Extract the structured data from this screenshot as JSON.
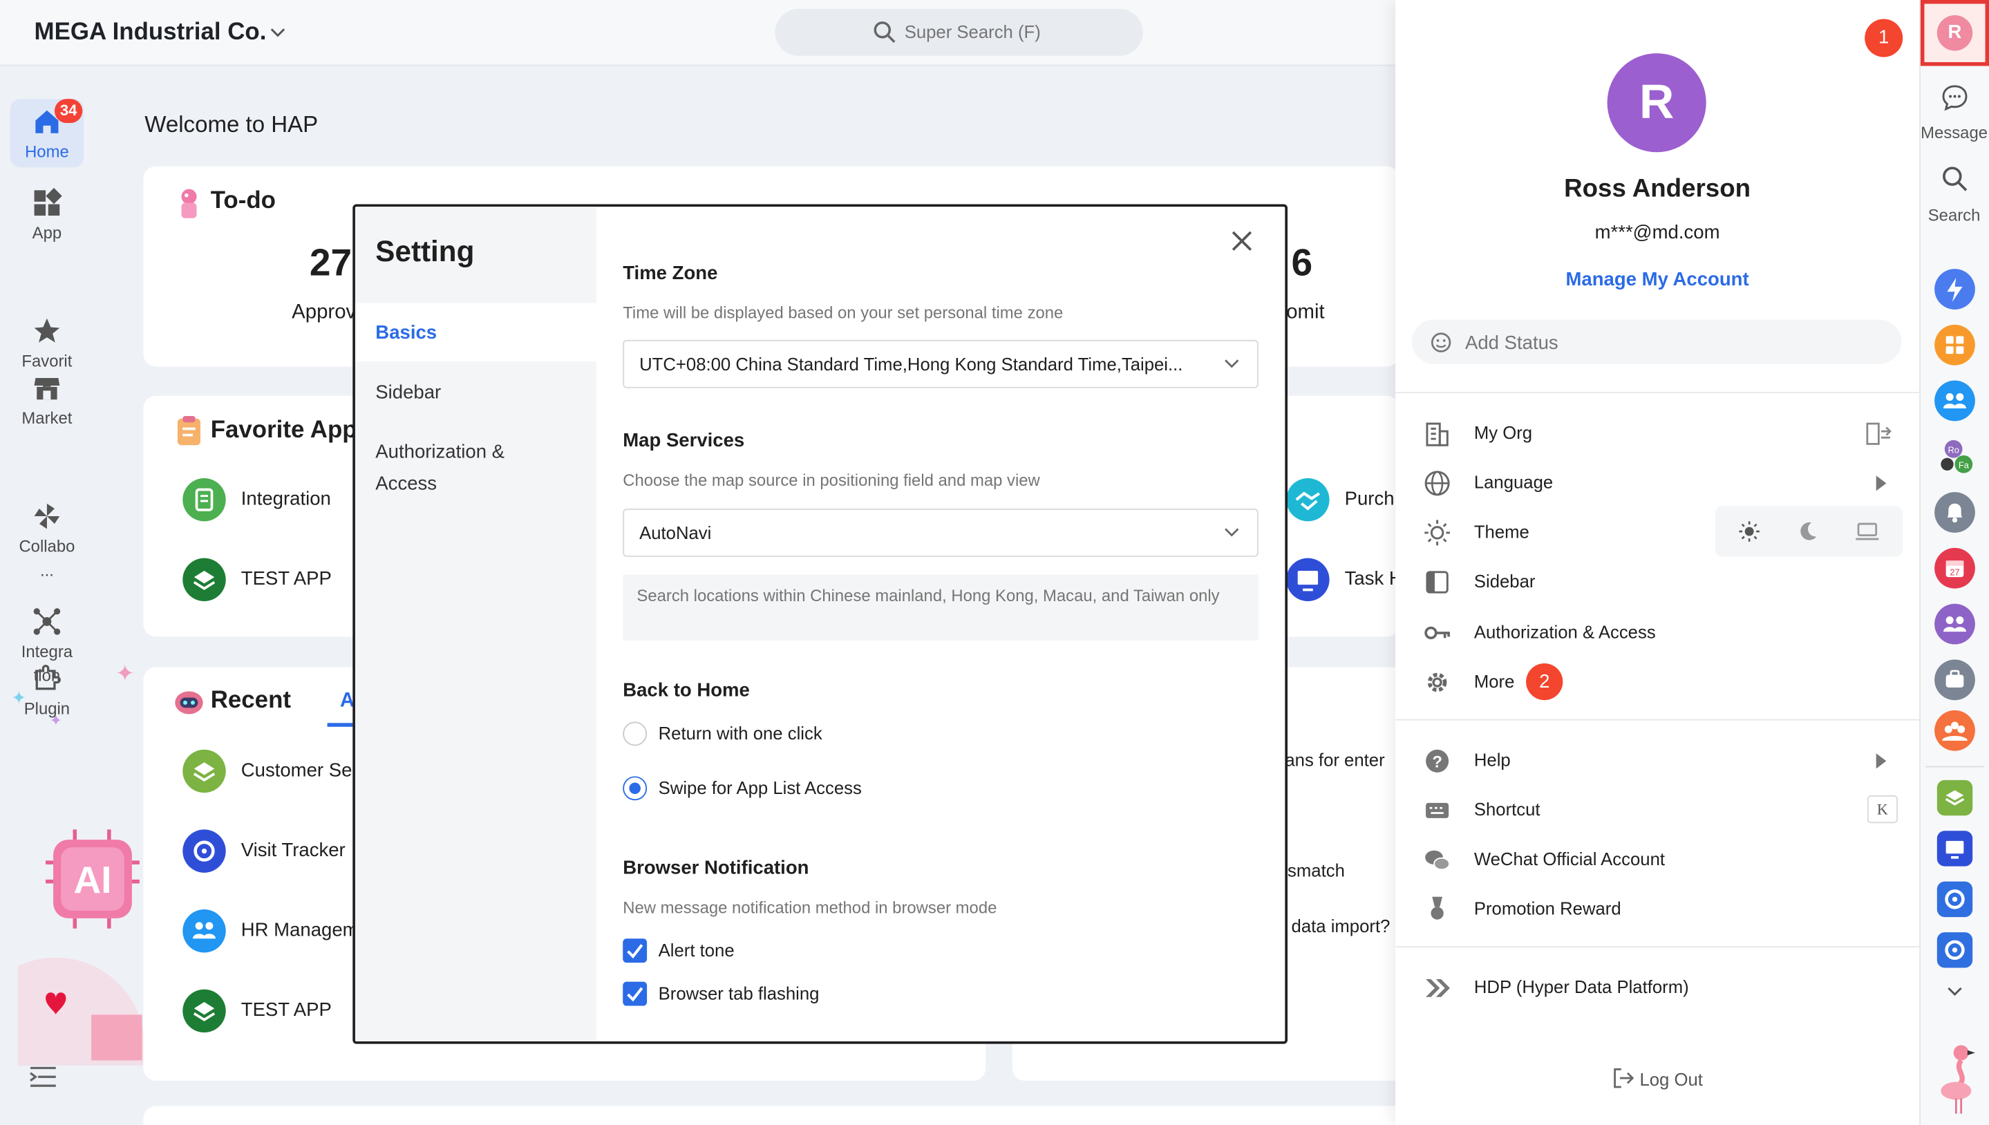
{
  "topbar": {
    "org_name": "MEGA Industrial Co.",
    "search_placeholder": "Super Search (F)"
  },
  "leftnav": {
    "home_badge": "34",
    "items": [
      {
        "label": "Home"
      },
      {
        "label": "App"
      },
      {
        "label": "Favorit\ne"
      },
      {
        "label": "Market"
      },
      {
        "label": "Collabo\n..."
      },
      {
        "label": "Integra\ntion"
      },
      {
        "label": "Plugin"
      }
    ]
  },
  "main": {
    "welcome": "Welcome to HAP",
    "todo": {
      "title": "To-do",
      "count_left": "27",
      "label_left": "Approv",
      "count_right": "6",
      "label_right": "omit"
    },
    "favorite": {
      "title": "Favorite App",
      "apps": [
        {
          "label": "Integration"
        },
        {
          "label": "TEST APP"
        },
        {
          "label": "Purch"
        },
        {
          "label": "Task H"
        }
      ]
    },
    "recent": {
      "title": "Recent",
      "tab_partial": "A",
      "apps": [
        {
          "label": "Customer Se"
        },
        {
          "label": "Visit Tracker"
        },
        {
          "label": "HR Managem"
        },
        {
          "label": "TEST APP"
        }
      ]
    },
    "right_card_lines": [
      "ans for enter",
      "smatch",
      "data import?"
    ]
  },
  "modal": {
    "title": "Setting",
    "side": {
      "basics": "Basics",
      "sidebar": "Sidebar",
      "auth": "Authorization &\nAccess"
    },
    "timezone": {
      "head": "Time Zone",
      "desc": "Time will be displayed based on your set personal time zone",
      "value": "UTC+08:00 China Standard Time,Hong Kong Standard Time,Taipei..."
    },
    "map": {
      "head": "Map Services",
      "desc": "Choose the map source in positioning field and map view",
      "value": "AutoNavi",
      "note": "Search locations within Chinese mainland, Hong Kong, Macau, and Taiwan only"
    },
    "home": {
      "head": "Back to Home",
      "opt1": "Return with one click",
      "opt2": "Swipe for App List Access"
    },
    "notify": {
      "head": "Browser Notification",
      "desc": "New message notification method in browser mode",
      "opt1": "Alert tone",
      "opt2": "Browser tab flashing"
    }
  },
  "account": {
    "avatar_letter": "R",
    "name": "Ross Anderson",
    "email": "m***@md.com",
    "manage": "Manage My Account",
    "status_placeholder": "Add Status",
    "menu": {
      "my_org": "My Org",
      "language": "Language",
      "theme": "Theme",
      "sidebar": "Sidebar",
      "auth": "Authorization & Access",
      "more": "More",
      "more_badge": "2",
      "help": "Help",
      "shortcut": "Shortcut",
      "shortcut_key": "K",
      "wechat": "WeChat Official Account",
      "promotion": "Promotion Reward",
      "hdp": "HDP (Hyper Data Platform)"
    },
    "logout": "Log Out"
  },
  "rail": {
    "avatar_letter": "R",
    "badge": "1",
    "message": "Message",
    "search": "Search",
    "mini_avatar_1": "Ro",
    "mini_avatar_2": "Fa"
  },
  "colors": {
    "accent": "#2b6be6",
    "badge_red": "#f4452e",
    "avatar_purple": "#9c5fd0"
  }
}
